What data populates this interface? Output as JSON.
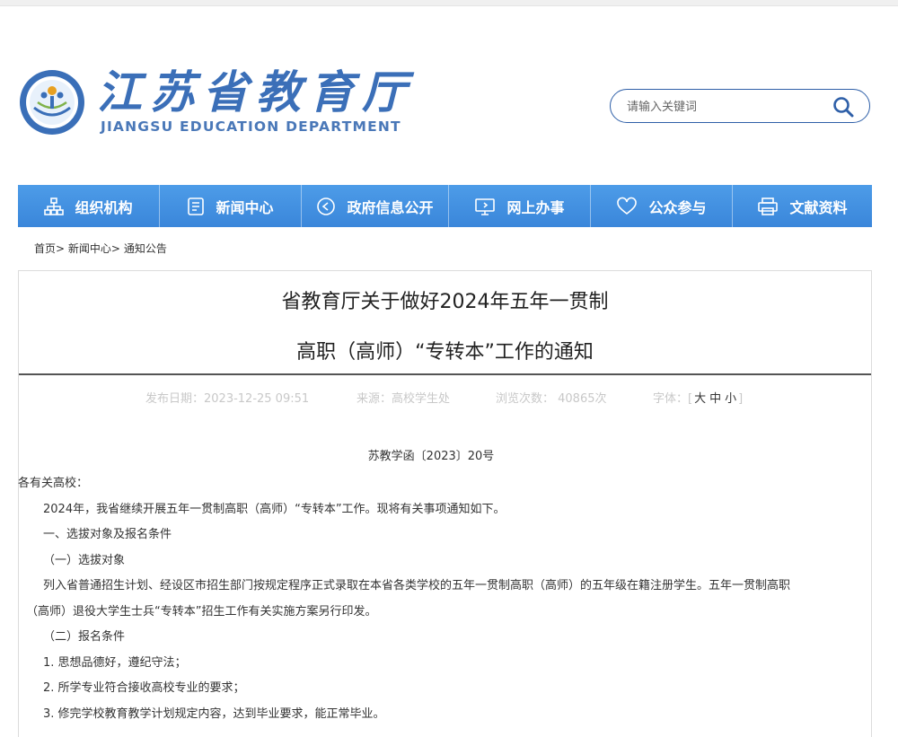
{
  "header": {
    "logo_cn": "江苏省教育厅",
    "logo_en": "JIANGSU EDUCATION DEPARTMENT",
    "search_placeholder": "请输入关键词"
  },
  "nav": {
    "items": [
      {
        "label": "组织机构",
        "icon": "org-chart-icon"
      },
      {
        "label": "新闻中心",
        "icon": "document-icon"
      },
      {
        "label": "政府信息公开",
        "icon": "play-circle-icon"
      },
      {
        "label": "网上办事",
        "icon": "monitor-icon"
      },
      {
        "label": "公众参与",
        "icon": "heart-icon"
      },
      {
        "label": "文献资料",
        "icon": "printer-icon"
      }
    ]
  },
  "breadcrumb": {
    "home": "首页",
    "sep": ">",
    "level1": "新闻中心",
    "level2": "通知公告"
  },
  "article": {
    "title_line1": "省教育厅关于做好2024年五年一贯制",
    "title_line2": "高职（高师）“专转本”工作的通知",
    "meta": {
      "date": "发布日期：2023-12-25 09:51",
      "source": "来源：高校学生处",
      "views": "浏览次数： 40865次",
      "font_label": "字体：",
      "font_open": "[",
      "font_large": "大",
      "font_medium": "中",
      "font_small": "小",
      "font_close": "]"
    },
    "doc_number": "苏教学函〔2023〕20号",
    "paragraphs": [
      "各有关高校：",
      "2024年，我省继续开展五年一贯制高职（高师）“专转本”工作。现将有关事项通知如下。",
      "一、选拔对象及报名条件",
      "（一）选拔对象",
      "列入省普通招生计划、经设区市招生部门按规定程序正式录取在本省各类学校的五年一贯制高职（高师）的五年级在籍注册学生。五年一贯制高职",
      "（高师）退役大学生士兵“专转本”招生工作有关实施方案另行印发。",
      "（二）报名条件",
      "1. 思想品德好，遵纪守法；",
      "2. 所学专业符合接收高校专业的要求；",
      "3. 修完学校教育教学计划规定内容，达到毕业要求，能正常毕业。"
    ]
  }
}
